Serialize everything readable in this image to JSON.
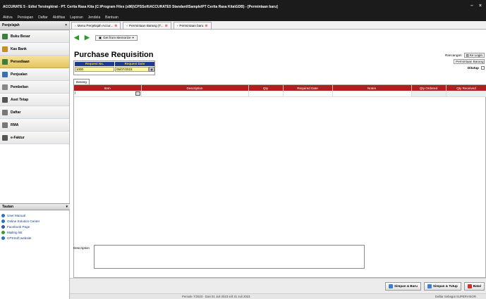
{
  "window": {
    "title": "ACCURATE 5 - Edisi Tersingkirat - PT. Cerita Rasa Kita (C:\\Program Files (x86)\\CPSSoft\\ACCURATE5 Standard\\Sample\\PT Cerita Rasa Kita\\GDB) - [Permintaan baru]",
    "controls": [
      "–",
      "×"
    ]
  },
  "menu": [
    "Aktiva",
    "Persiapan",
    "Daftar",
    "Aktifitas",
    "Laporan",
    "Jendela",
    "Bantuan"
  ],
  "sidebar": {
    "header": "Penjelajah",
    "items": [
      {
        "label": "Buku Besar",
        "icon": "ledger-icon",
        "color": "#3d7e3d"
      },
      {
        "label": "Kas Bank",
        "icon": "bank-icon",
        "color": "#c98f1c"
      },
      {
        "label": "Persediaan",
        "icon": "inventory-icon",
        "color": "#3d7e3d"
      },
      {
        "label": "Penjualan",
        "icon": "sales-icon",
        "color": "#3a6fb4"
      },
      {
        "label": "Pembelian",
        "icon": "purchase-icon",
        "color": "#888888"
      },
      {
        "label": "Aset Tetap",
        "icon": "asset-icon",
        "color": "#555555"
      },
      {
        "label": "Daftar",
        "icon": "list-icon",
        "color": "#777777"
      },
      {
        "label": "RMA",
        "icon": "rma-icon",
        "color": "#777777"
      },
      {
        "label": "e-Faktur",
        "icon": "efaktur-icon",
        "color": "#555555"
      }
    ],
    "active_index": 2,
    "links_header": "Tautan",
    "links": [
      {
        "label": "User Manual",
        "color": "#2f6fc4"
      },
      {
        "label": "Online Solution Center",
        "color": "#2f6fc4"
      },
      {
        "label": "Facebook Page",
        "color": "#3b5998"
      },
      {
        "label": "Mailing list",
        "color": "#3a9a3a"
      },
      {
        "label": "CPSSoft website",
        "color": "#2f6fc4"
      }
    ]
  },
  "tabs": [
    {
      "label": "Menu Penjelajah Accur..."
    },
    {
      "label": "Permintaan Barang (T..."
    },
    {
      "label": "Permintaan baru"
    }
  ],
  "toolbar": {
    "back": "◀",
    "forward": "▶",
    "menu_button": "Get from Memorize"
  },
  "form": {
    "title": "Purchase Requisition",
    "request_no_label": "Request No.",
    "request_date_label": "Request Date",
    "request_no": "1000",
    "request_date": "05/07/2023",
    "rancangan_label": "Rancangan",
    "ke_login_label": "Ke Login",
    "rancangan_value": "Permintaan Barang",
    "ditutup_label": "Ditutup",
    "subtab": "Barang",
    "columns": [
      "Item",
      "Description",
      "Qty",
      "Required Date",
      "Notes",
      "Qty Ordered",
      "Qty Received"
    ],
    "description_label": "Description"
  },
  "buttons": {
    "save_new": "Simpan & Baru",
    "save_close": "Simpan & Tutup",
    "cancel": "Batal"
  },
  "status": {
    "period": "Periode 7/2023 - Dari 01 Juli 2023 s/d 31 Juli 2023",
    "user": "Daftar Sebagai SUPERVISOR"
  }
}
